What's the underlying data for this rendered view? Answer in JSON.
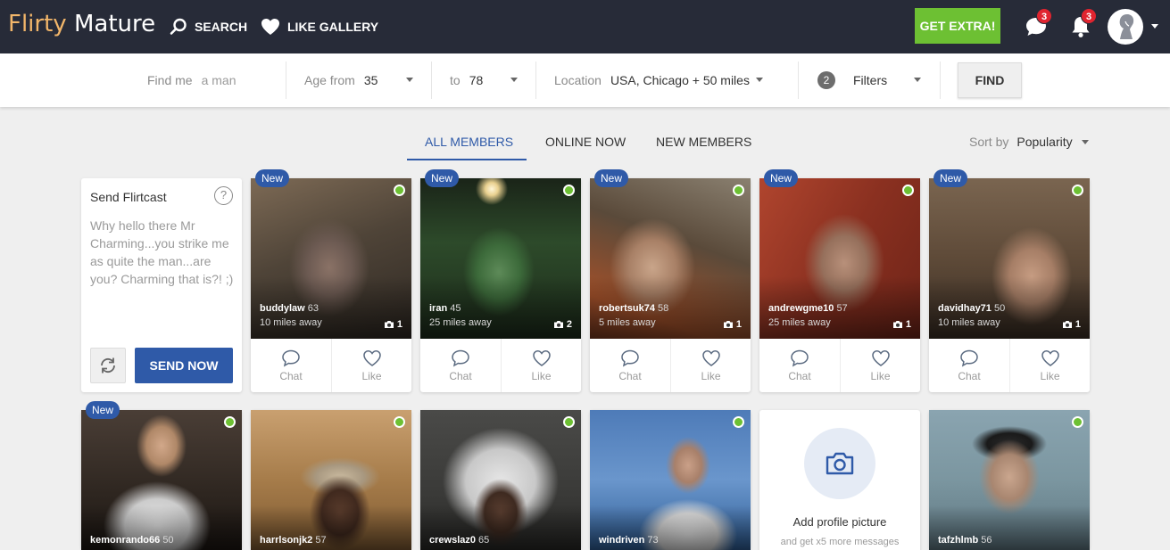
{
  "nav": {
    "logo_part1": "Flirty",
    "logo_part2": "Mature",
    "search_label": "SEARCH",
    "like_gallery_label": "LIKE GALLERY",
    "get_extra_label": "GET EXTRA!",
    "messages_badge": "3",
    "notifications_badge": "3",
    "search_icon": "search-icon",
    "heart_icon": "heart-icon",
    "chat_icon": "chat-bubble-icon",
    "bell_icon": "bell-icon"
  },
  "search": {
    "find_me_label": "Find me",
    "find_me_value": "a man",
    "age_from_label": "Age from",
    "age_from_value": "35",
    "age_to_label": "to",
    "age_to_value": "78",
    "location_label": "Location",
    "location_value": "USA, Chicago + 50 miles",
    "filter_count": "2",
    "filters_label": "Filters",
    "find_button": "FIND"
  },
  "tabs": {
    "all_members": "ALL MEMBERS",
    "online_now": "ONLINE NOW",
    "new_members": "NEW MEMBERS",
    "sort_label": "Sort by",
    "sort_value": "Popularity"
  },
  "flirtcast": {
    "title": "Send Flirtcast",
    "help": "?",
    "message": "Why hello there Mr Charming...you strike me as quite the man...are you? Charming that is?! ;)",
    "send_button": "SEND NOW"
  },
  "labels": {
    "new": "New",
    "chat": "Chat",
    "like": "Like"
  },
  "members": [
    {
      "name": "buddylaw",
      "age": "63",
      "distance": "10 miles away",
      "photos": "1"
    },
    {
      "name": "iran",
      "age": "45",
      "distance": "25 miles away",
      "photos": "2"
    },
    {
      "name": "robertsuk74",
      "age": "58",
      "distance": "5 miles away",
      "photos": "1"
    },
    {
      "name": "andrewgme10",
      "age": "57",
      "distance": "25 miles away",
      "photos": "1"
    },
    {
      "name": "davidhay71",
      "age": "50",
      "distance": "10 miles away",
      "photos": "1"
    },
    {
      "name": "kemonrando66",
      "age": "50"
    },
    {
      "name": "harrlsonjk2",
      "age": "57"
    },
    {
      "name": "crewslaz0",
      "age": "65"
    },
    {
      "name": "windriven",
      "age": "73"
    },
    {
      "name": "tafzhlmb",
      "age": "56"
    }
  ],
  "add_photo": {
    "title": "Add profile picture",
    "subtitle": "and get x5 more messages",
    "icon": "camera-icon"
  },
  "colors": {
    "nav_bg": "#272b38",
    "brand_blue": "#2f5aa8",
    "extra_green": "#6dc033",
    "badge_red": "#e0242f",
    "logo_gold": "#f2b66a"
  }
}
